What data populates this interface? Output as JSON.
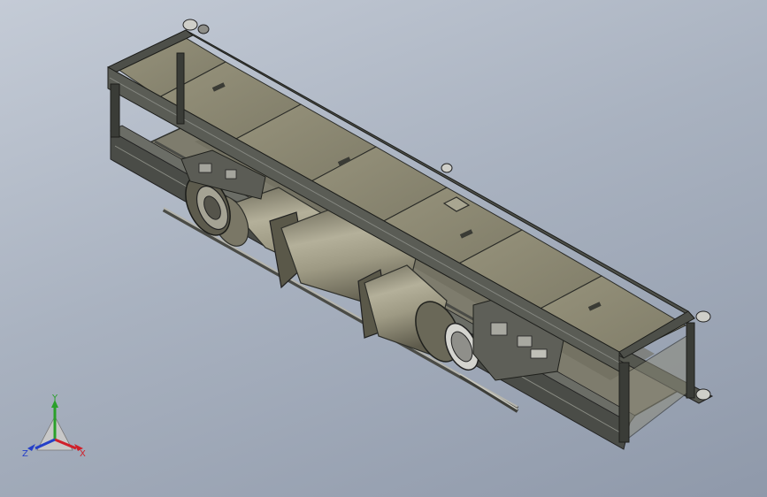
{
  "viewport": {
    "background_top": "#c4cbd6",
    "background_bottom": "#8f99aa"
  },
  "model": {
    "frame_color": "#3a3d38",
    "panel_color": "#8d8a74",
    "panel_dark": "#6f6d5c",
    "cylinder_color": "#9e9a84",
    "cylinder_shade": "#6a6756",
    "rail_color": "#8c8c86"
  },
  "triad": {
    "x_label": "X",
    "y_label": "Y",
    "z_label": "Z",
    "x_color": "#d0202a",
    "y_color": "#2aa02a",
    "z_color": "#2540c8"
  }
}
